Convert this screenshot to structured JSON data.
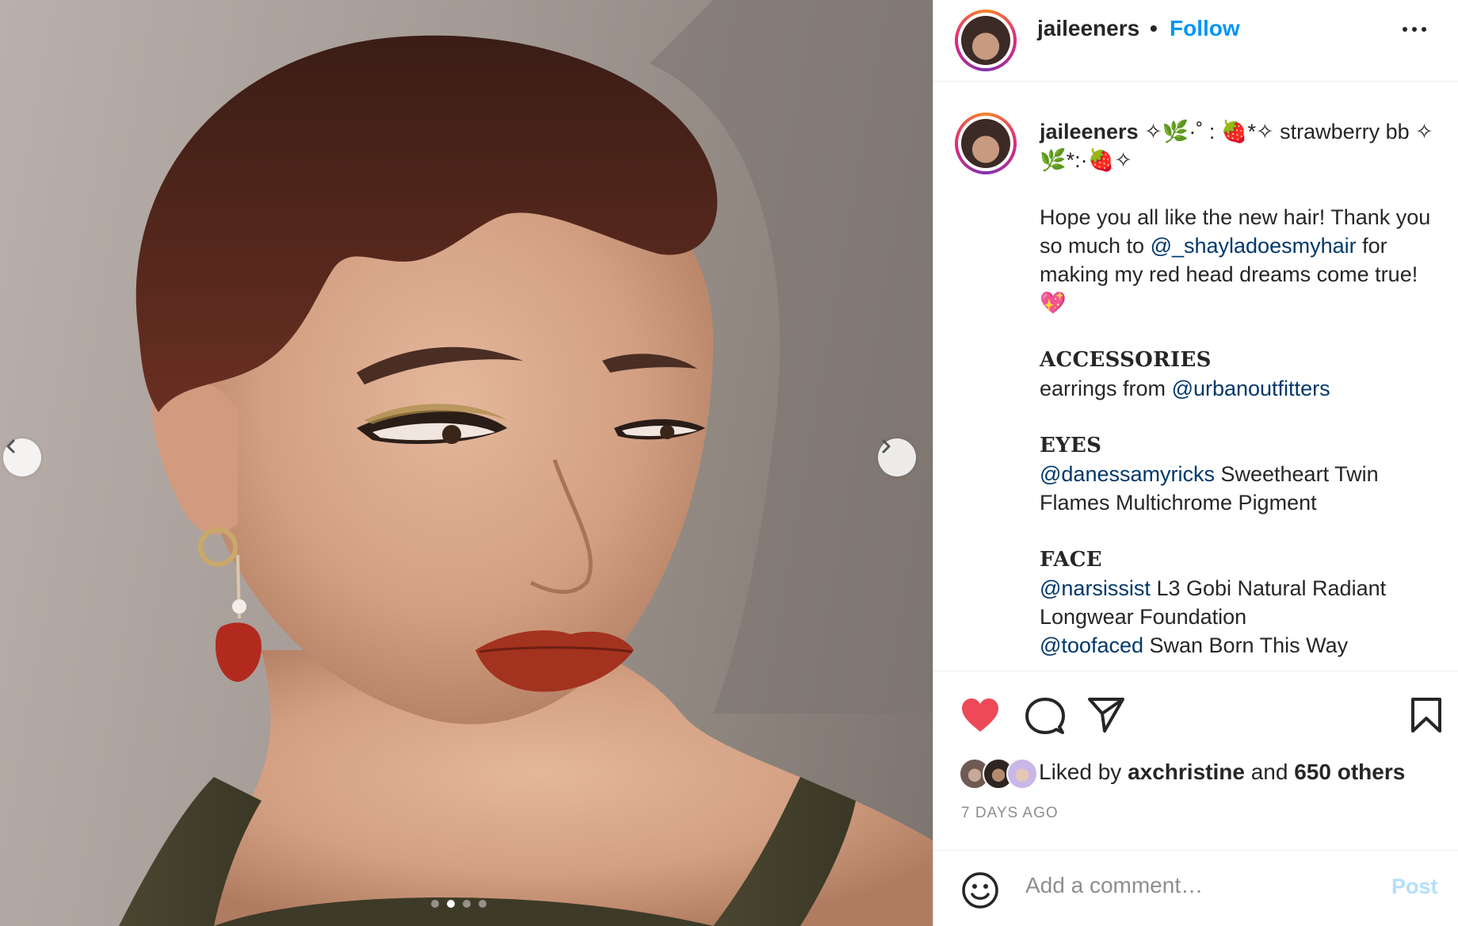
{
  "post": {
    "username": "jaileeners",
    "follow_label": "Follow",
    "separator": "•",
    "more_icon": "more-horizontal-icon"
  },
  "media": {
    "prev_icon": "chevron-left-icon",
    "next_icon": "chevron-right-icon",
    "carousel_count": 4,
    "carousel_active_index": 1
  },
  "caption": {
    "username": "jaileeners",
    "title_line": "✧🌿·˚ : 🍓*✧ strawberry bb ✧🌿*:·🍓✧",
    "intro_1": "Hope you all like the new hair! Thank you so much to ",
    "intro_mention": "@_shayladoesmyhair",
    "intro_2": " for making my red head dreams come true! 💖",
    "accessories_heading": "ACCESSORIES",
    "accessories_1": "earrings from ",
    "accessories_mention": "@urbanoutfitters",
    "eyes_heading": "EYES",
    "eyes_mention": "@danessamyricks",
    "eyes_text": " Sweetheart Twin Flames Multichrome Pigment",
    "face_heading": "FACE",
    "face_mention_1": "@narsissist",
    "face_text_1": " L3 Gobi Natural Radiant Longwear Foundation",
    "face_mention_2": "@toofaced",
    "face_text_2": " Swan Born This Way"
  },
  "actions": {
    "like_icon": "heart-filled-icon",
    "comment_icon": "comment-icon",
    "share_icon": "share-icon",
    "save_icon": "bookmark-icon",
    "liked_prefix": "Liked by ",
    "liked_user": "axchristine",
    "liked_mid": " and ",
    "liked_others": "650 others",
    "timestamp": "7 DAYS AGO"
  },
  "comment": {
    "emoji_icon": "emoji-smile-icon",
    "placeholder": "Add a comment…",
    "post_label": "Post"
  },
  "colors": {
    "accent": "#0095f6",
    "mention": "#00376b",
    "like_red": "#ed4956",
    "post_disabled": "#b2dffc",
    "muted": "#8e8e8e"
  }
}
